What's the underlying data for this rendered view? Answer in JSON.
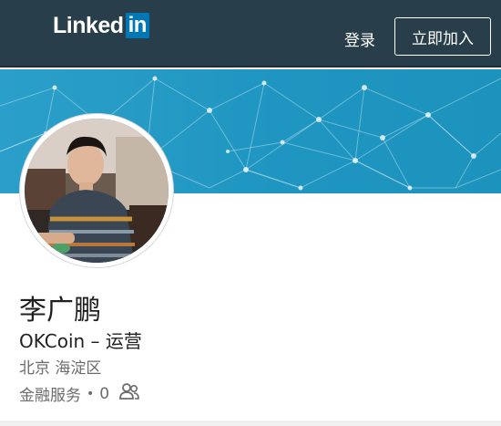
{
  "header": {
    "logo_text": "Linked",
    "logo_in": "in",
    "login_label": "登录",
    "join_label": "立即加入",
    "bg_color": "#283e4a",
    "logo_accent": "#0077b5"
  },
  "banner": {
    "color": "#1f96c1"
  },
  "profile": {
    "name": "李广鹏",
    "headline": "OKCoin – 运营",
    "location": "北京 海淀区",
    "industry": "金融服务",
    "separator": "•",
    "connections": "0",
    "connections_icon": "people-icon"
  }
}
